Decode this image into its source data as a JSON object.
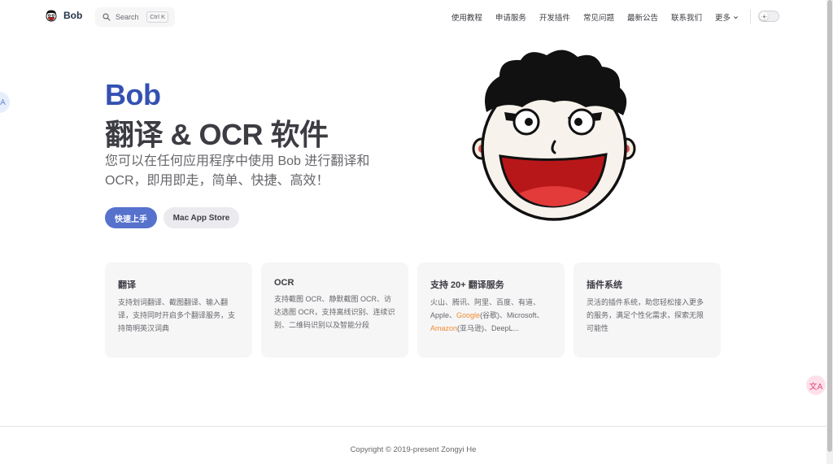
{
  "nav": {
    "brand": "Bob",
    "search_label": "Search",
    "search_shortcut": "Ctrl K",
    "items": [
      {
        "label": "使用教程"
      },
      {
        "label": "申请服务"
      },
      {
        "label": "开发插件"
      },
      {
        "label": "常见问题"
      },
      {
        "label": "最新公告"
      },
      {
        "label": "联系我们"
      }
    ],
    "more_label": "更多"
  },
  "hero": {
    "name": "Bob",
    "text": "翻译 & OCR 软件",
    "tagline": "您可以在任何应用程序中使用 Bob 进行翻译和 OCR，即用即走，简单、快捷、高效！",
    "primary_action": "快速上手",
    "secondary_action": "Mac App Store"
  },
  "features": [
    {
      "title": "翻译",
      "desc": "支持划词翻译、截图翻译、输入翻译，支持同时开启多个翻译服务，支持简明英汉词典"
    },
    {
      "title": "OCR",
      "desc": "支持截图 OCR、静默截图 OCR、访达选图 OCR，支持离线识别、连续识别、二维码识别以及智能分段"
    },
    {
      "title": "支持 20+ 翻译服务",
      "desc_parts": [
        "火山、腾讯、阿里、百度、有道、Apple、",
        "Google",
        "(谷歌)、Microsoft、",
        "Amazon",
        "(亚马逊)、DeepL..."
      ]
    },
    {
      "title": "插件系统",
      "desc": "灵活的插件系统，助您轻松接入更多的服务，满足个性化需求，探索无限可能性"
    }
  ],
  "footer": "Copyright © 2019-present Zongyi He",
  "float_right_glyph": "文A",
  "icons": [
    "bob-logo-icon",
    "search-icon",
    "chevron-down-icon",
    "sun-icon",
    "translate-icon"
  ],
  "colors": {
    "brand": "#3451b2",
    "accent_highlight": "#f08c2c"
  }
}
